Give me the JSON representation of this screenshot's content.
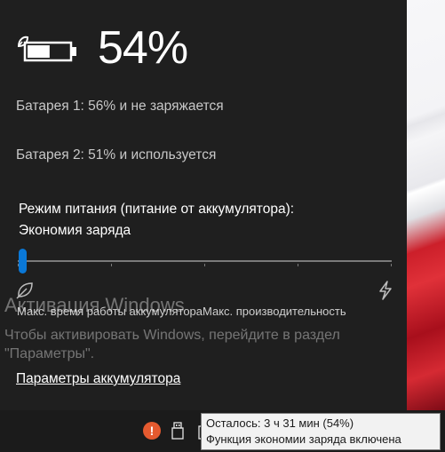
{
  "flyout": {
    "percent": "54%",
    "battery1": "Батарея 1: 56% и не заряжается",
    "battery2": "Батарея 2: 51% и используется",
    "power_mode_title": "Режим питания (питание от аккумулятора):",
    "power_mode_value": "Экономия заряда",
    "slider": {
      "level": 0,
      "ticks": 5
    },
    "slider_labels": "Макс. время работы аккумулятораМакс. производительность",
    "settings_link": "Параметры аккумулятора"
  },
  "watermark": {
    "title": "Активация Windows",
    "text": "Чтобы активировать Windows, перейдите в раздел \"Параметры\"."
  },
  "tooltip": {
    "line1": "Осталось: 3 ч 31 мин (54%)",
    "line2": "Функция экономии заряда включена"
  },
  "icons": {
    "battery": "battery-saver-icon",
    "leaf": "leaf-icon",
    "bolt": "bolt-icon",
    "warning": "warning-icon",
    "usb": "usb-icon"
  },
  "colors": {
    "accent": "#0a78d7",
    "flyout_bg": "#1f1f1f",
    "warning": "#e55a2f"
  }
}
